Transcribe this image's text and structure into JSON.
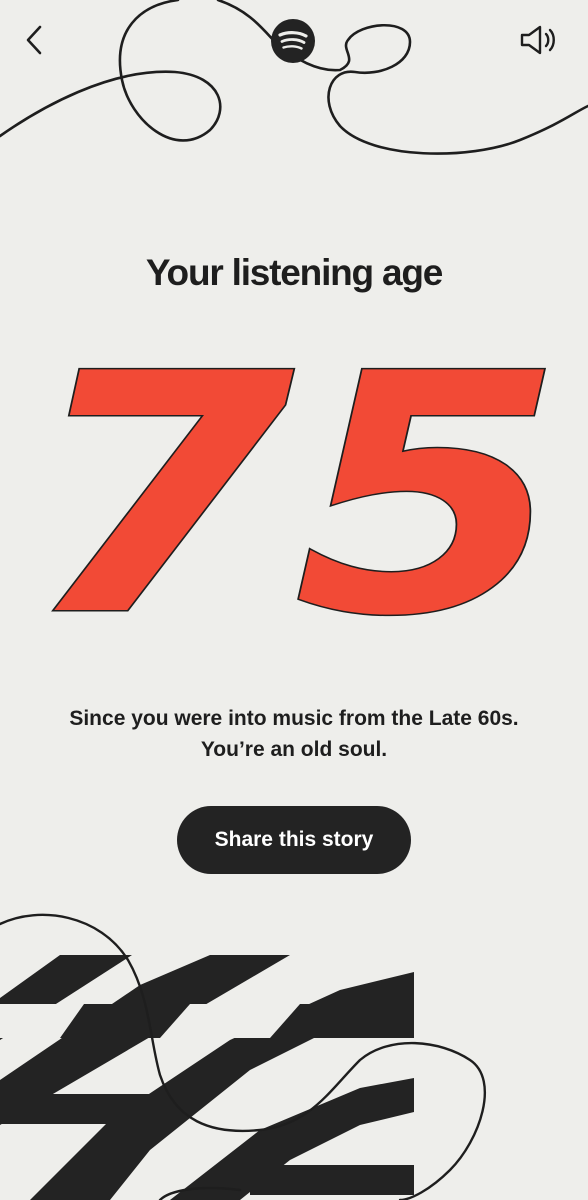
{
  "header": {
    "back_icon": "chevron-left-icon",
    "logo_icon": "spotify-logo-icon",
    "sound_icon": "speaker-icon"
  },
  "story": {
    "title": "Your listening age",
    "age": "75",
    "description_line1": "Since you were into music from the Late 60s.",
    "description_line2": "You’re an old soul.",
    "share_label": "Share this story"
  },
  "colors": {
    "background": "#EEEEEB",
    "accent": "#F24A36",
    "ink": "#1E1E1E",
    "button": "#232323",
    "button_text": "#FFFFFF"
  }
}
